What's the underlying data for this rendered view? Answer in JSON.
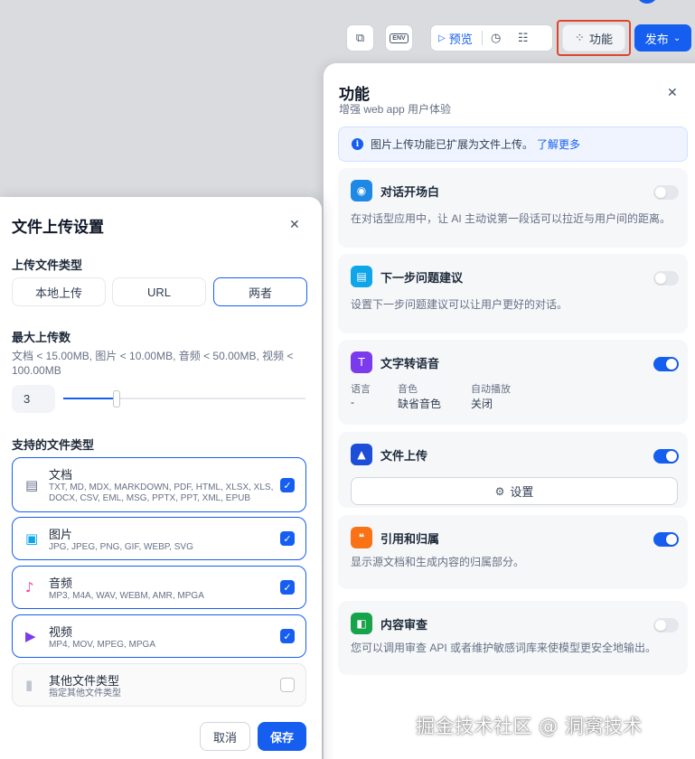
{
  "toolbar": {
    "preview_label": "预览",
    "features_label": "功能",
    "publish_label": "发布",
    "env_label": "ENV"
  },
  "features_panel": {
    "title": "功能",
    "subtitle": "增强 web app 用户体验",
    "info_text": "图片上传功能已扩展为文件上传。",
    "info_link": "了解更多",
    "cards": [
      {
        "title": "对话开场白",
        "desc": "在对话型应用中，让 AI 主动说第一段话可以拉近与用户间的距离。",
        "enabled": false,
        "icon_color": "#1e88e5"
      },
      {
        "title": "下一步问题建议",
        "desc": "设置下一步问题建议可以让用户更好的对话。",
        "enabled": false,
        "icon_color": "#0ea5e9"
      },
      {
        "title": "文字转语音",
        "enabled": true,
        "icon_color": "#7c3aed",
        "meta": [
          {
            "label": "语言",
            "value": "-"
          },
          {
            "label": "音色",
            "value": "缺省音色"
          },
          {
            "label": "自动播放",
            "value": "关闭"
          }
        ]
      },
      {
        "title": "文件上传",
        "enabled": true,
        "icon_color": "#1d4ed8",
        "settings_label": "设置"
      },
      {
        "title": "引用和归属",
        "desc": "显示源文档和生成内容的归属部分。",
        "enabled": true,
        "icon_color": "#f97316"
      },
      {
        "title": "内容审查",
        "desc": "您可以调用审查 API 或者维护敏感词库来使模型更安全地输出。",
        "enabled": false,
        "icon_color": "#16a34a"
      }
    ]
  },
  "upload_modal": {
    "title": "文件上传设置",
    "upload_type_label": "上传文件类型",
    "upload_types": [
      "本地上传",
      "URL",
      "两者"
    ],
    "selected_upload_type": "两者",
    "max_uploads_label": "最大上传数",
    "limits_text": "文档 < 15.00MB, 图片 < 10.00MB, 音频 < 50.00MB, 视频 < 100.00MB",
    "max_uploads_value": "3",
    "max_uploads_fraction": 0.22,
    "supported_types_label": "支持的文件类型",
    "file_types": [
      {
        "name": "文档",
        "exts": "TXT, MD, MDX, MARKDOWN, PDF, HTML, XLSX, XLS, DOCX, CSV, EML, MSG, PPTX, PPT, XML, EPUB",
        "checked": true,
        "icon_color": "#667085"
      },
      {
        "name": "图片",
        "exts": "JPG, JPEG, PNG, GIF, WEBP, SVG",
        "checked": true,
        "icon_color": "#0ea5e9"
      },
      {
        "name": "音频",
        "exts": "MP3, M4A, WAV, WEBM, AMR, MPGA",
        "checked": true,
        "icon_color": "#ec4899"
      },
      {
        "name": "视频",
        "exts": "MP4, MOV, MPEG, MPGA",
        "checked": true,
        "icon_color": "#7c3aed"
      },
      {
        "name": "其他文件类型",
        "exts": "指定其他文件类型",
        "checked": false,
        "icon_color": "#c0c5ce"
      }
    ],
    "cancel_label": "取消",
    "save_label": "保存"
  },
  "watermark": "掘金技术社区 @ 洞窝技术"
}
